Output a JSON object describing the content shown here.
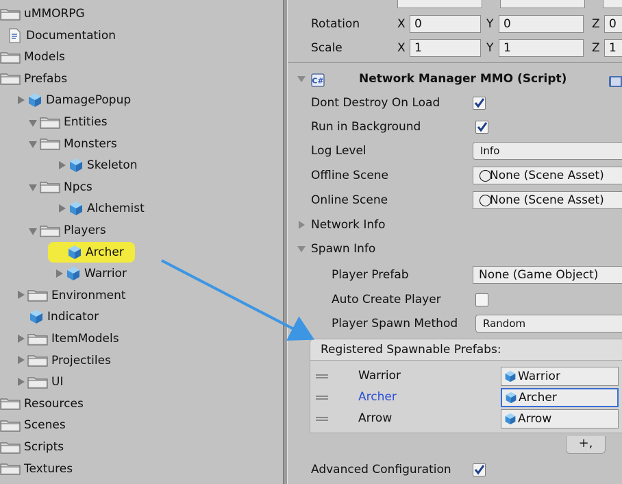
{
  "project_tree": {
    "items": [
      {
        "label": "uMMORPG",
        "icon": "folder-icon",
        "arrow": "none"
      },
      {
        "label": "Documentation",
        "icon": "document-icon",
        "arrow": "none"
      },
      {
        "label": "Models",
        "icon": "folder-icon",
        "arrow": "none"
      },
      {
        "label": "Prefabs",
        "icon": "folder-icon",
        "arrow": "none"
      },
      {
        "label": "DamagePopup",
        "icon": "prefab-cube-icon",
        "arrow": "collapsed"
      },
      {
        "label": "Entities",
        "icon": "folder-icon",
        "arrow": "expanded"
      },
      {
        "label": "Monsters",
        "icon": "folder-icon",
        "arrow": "expanded"
      },
      {
        "label": "Skeleton",
        "icon": "prefab-cube-icon",
        "arrow": "collapsed"
      },
      {
        "label": "Npcs",
        "icon": "folder-icon",
        "arrow": "expanded"
      },
      {
        "label": "Alchemist",
        "icon": "prefab-cube-icon",
        "arrow": "collapsed"
      },
      {
        "label": "Players",
        "icon": "folder-icon",
        "arrow": "expanded"
      },
      {
        "label": "Archer",
        "icon": "prefab-cube-icon",
        "arrow": "none",
        "highlighted": true
      },
      {
        "label": "Warrior",
        "icon": "prefab-cube-icon",
        "arrow": "collapsed"
      },
      {
        "label": "Environment",
        "icon": "folder-icon",
        "arrow": "collapsed"
      },
      {
        "label": "Indicator",
        "icon": "prefab-cube-icon",
        "arrow": "none"
      },
      {
        "label": "ItemModels",
        "icon": "folder-icon",
        "arrow": "collapsed"
      },
      {
        "label": "Projectiles",
        "icon": "folder-icon",
        "arrow": "collapsed"
      },
      {
        "label": "UI",
        "icon": "folder-icon",
        "arrow": "collapsed"
      },
      {
        "label": "Resources",
        "icon": "folder-icon",
        "arrow": "none"
      },
      {
        "label": "Scenes",
        "icon": "folder-icon",
        "arrow": "none"
      },
      {
        "label": "Scripts",
        "icon": "folder-icon",
        "arrow": "none"
      },
      {
        "label": "Textures",
        "icon": "folder-icon",
        "arrow": "none"
      }
    ],
    "highlight_color": "#f2ea3c"
  },
  "transform": {
    "rotation_label": "Rotation",
    "scale_label": "Scale",
    "axis_x": "X",
    "axis_y": "Y",
    "axis_z": "Z",
    "rotation": {
      "x": "0",
      "y": "0",
      "z": "0"
    },
    "scale": {
      "x": "1",
      "y": "1",
      "z": "1"
    }
  },
  "component": {
    "title": "Network Manager MMO (Script)",
    "script_icon": "csharp-script-icon",
    "dont_destroy_label": "Dont Destroy On Load",
    "dont_destroy_checked": true,
    "run_in_background_label": "Run in Background",
    "run_in_background_checked": true,
    "log_level_label": "Log Level",
    "log_level_value": "Info",
    "offline_scene_label": "Offline Scene",
    "offline_scene_value": "None (Scene Asset)",
    "online_scene_label": "Online Scene",
    "online_scene_value": "None (Scene Asset)",
    "network_info_label": "Network Info",
    "spawn_info_label": "Spawn Info",
    "player_prefab_label": "Player Prefab",
    "player_prefab_value": "None (Game Object)",
    "auto_create_label": "Auto Create Player",
    "auto_create_checked": false,
    "spawn_method_label": "Player Spawn Method",
    "spawn_method_value": "Random",
    "registered_header": "Registered Spawnable Prefabs:",
    "registered": [
      {
        "name": "Warrior",
        "value": "Warrior",
        "selected": false
      },
      {
        "name": "Archer",
        "value": "Archer",
        "selected": true
      },
      {
        "name": "Arrow",
        "value": "Arrow",
        "selected": false
      }
    ],
    "add_button": "+,",
    "advanced_label": "Advanced Configuration",
    "advanced_checked": true
  },
  "colors": {
    "selected_name": "#2a4fd6",
    "callout_arrow": "#3d96e3",
    "selected_border": "#3a6fd4"
  }
}
